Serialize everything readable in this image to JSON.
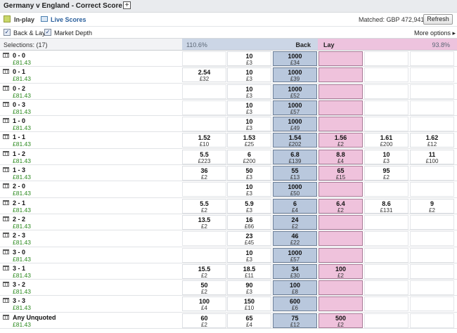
{
  "market": {
    "title": "Germany v England - Correct Score",
    "inplay_label": "In-play",
    "live_scores_label": "Live Scores",
    "matched_text": "Matched: GBP 472,941",
    "refresh_label": "Refresh"
  },
  "options": {
    "back_lay_label": "Back & Lay",
    "market_depth_label": "Market Depth",
    "more_options_label": "More options ▸",
    "back_lay_checked": true,
    "market_depth_checked": true
  },
  "header": {
    "selections_label": "Selections:  (17)",
    "back_pct": "110.6%",
    "back_label": "Back",
    "lay_label": "Lay",
    "lay_pct": "93.8%"
  },
  "colors": {
    "best_back": "#b9c8dd",
    "best_lay": "#efc2dc",
    "profit_green": "#2c8a1f"
  },
  "runners": [
    {
      "name": "0 - 0",
      "pl": "£81.43",
      "back": [
        null,
        {
          "p": "10",
          "s": "£3"
        },
        {
          "p": "1000",
          "s": "£34"
        }
      ],
      "lay": [
        null,
        null,
        null
      ]
    },
    {
      "name": "0 - 1",
      "pl": "£81.43",
      "back": [
        {
          "p": "2.54",
          "s": "£32"
        },
        {
          "p": "10",
          "s": "£3"
        },
        {
          "p": "1000",
          "s": "£39"
        }
      ],
      "lay": [
        null,
        null,
        null
      ]
    },
    {
      "name": "0 - 2",
      "pl": "£81.43",
      "back": [
        null,
        {
          "p": "10",
          "s": "£3"
        },
        {
          "p": "1000",
          "s": "£52"
        }
      ],
      "lay": [
        null,
        null,
        null
      ]
    },
    {
      "name": "0 - 3",
      "pl": "£81.43",
      "back": [
        null,
        {
          "p": "10",
          "s": "£3"
        },
        {
          "p": "1000",
          "s": "£57"
        }
      ],
      "lay": [
        null,
        null,
        null
      ]
    },
    {
      "name": "1 - 0",
      "pl": "£81.43",
      "back": [
        null,
        {
          "p": "10",
          "s": "£3"
        },
        {
          "p": "1000",
          "s": "£49"
        }
      ],
      "lay": [
        null,
        null,
        null
      ]
    },
    {
      "name": "1 - 1",
      "pl": "£81.43",
      "back": [
        {
          "p": "1.52",
          "s": "£10"
        },
        {
          "p": "1.53",
          "s": "£25"
        },
        {
          "p": "1.54",
          "s": "£202"
        }
      ],
      "lay": [
        {
          "p": "1.56",
          "s": "£2"
        },
        {
          "p": "1.61",
          "s": "£200"
        },
        {
          "p": "1.62",
          "s": "£12"
        }
      ]
    },
    {
      "name": "1 - 2",
      "pl": "£81.43",
      "back": [
        {
          "p": "5.5",
          "s": "£223"
        },
        {
          "p": "6",
          "s": "£200"
        },
        {
          "p": "6.8",
          "s": "£139"
        }
      ],
      "lay": [
        {
          "p": "8.8",
          "s": "£4"
        },
        {
          "p": "10",
          "s": "£3"
        },
        {
          "p": "11",
          "s": "£100"
        }
      ]
    },
    {
      "name": "1 - 3",
      "pl": "£81.43",
      "back": [
        {
          "p": "36",
          "s": "£2"
        },
        {
          "p": "50",
          "s": "£3"
        },
        {
          "p": "55",
          "s": "£13"
        }
      ],
      "lay": [
        {
          "p": "65",
          "s": "£15"
        },
        {
          "p": "95",
          "s": "£2"
        },
        null
      ]
    },
    {
      "name": "2 - 0",
      "pl": "£81.43",
      "back": [
        null,
        {
          "p": "10",
          "s": "£3"
        },
        {
          "p": "1000",
          "s": "£50"
        }
      ],
      "lay": [
        null,
        null,
        null
      ]
    },
    {
      "name": "2 - 1",
      "pl": "£81.43",
      "back": [
        {
          "p": "5.5",
          "s": "£2"
        },
        {
          "p": "5.9",
          "s": "£3"
        },
        {
          "p": "6",
          "s": "£4"
        }
      ],
      "lay": [
        {
          "p": "6.4",
          "s": "£2"
        },
        {
          "p": "8.6",
          "s": "£131"
        },
        {
          "p": "9",
          "s": "£2"
        }
      ]
    },
    {
      "name": "2 - 2",
      "pl": "£81.43",
      "back": [
        {
          "p": "13.5",
          "s": "£2"
        },
        {
          "p": "16",
          "s": "£66"
        },
        {
          "p": "24",
          "s": "£2"
        }
      ],
      "lay": [
        null,
        null,
        null
      ]
    },
    {
      "name": "2 - 3",
      "pl": "£81.43",
      "back": [
        null,
        {
          "p": "23",
          "s": "£45"
        },
        {
          "p": "46",
          "s": "£22"
        }
      ],
      "lay": [
        null,
        null,
        null
      ]
    },
    {
      "name": "3 - 0",
      "pl": "£81.43",
      "back": [
        null,
        {
          "p": "10",
          "s": "£3"
        },
        {
          "p": "1000",
          "s": "£57"
        }
      ],
      "lay": [
        null,
        null,
        null
      ]
    },
    {
      "name": "3 - 1",
      "pl": "£81.43",
      "back": [
        {
          "p": "15.5",
          "s": "£2"
        },
        {
          "p": "18.5",
          "s": "£11"
        },
        {
          "p": "34",
          "s": "£30"
        }
      ],
      "lay": [
        {
          "p": "100",
          "s": "£2"
        },
        null,
        null
      ]
    },
    {
      "name": "3 - 2",
      "pl": "£81.43",
      "back": [
        {
          "p": "50",
          "s": "£2"
        },
        {
          "p": "90",
          "s": "£3"
        },
        {
          "p": "100",
          "s": "£8"
        }
      ],
      "lay": [
        null,
        null,
        null
      ]
    },
    {
      "name": "3 - 3",
      "pl": "£81.43",
      "back": [
        {
          "p": "100",
          "s": "£4"
        },
        {
          "p": "150",
          "s": "£10"
        },
        {
          "p": "600",
          "s": "£6"
        }
      ],
      "lay": [
        null,
        null,
        null
      ]
    },
    {
      "name": "Any Unquoted",
      "pl": "£81.43",
      "back": [
        {
          "p": "60",
          "s": "£2"
        },
        {
          "p": "65",
          "s": "£4"
        },
        {
          "p": "75",
          "s": "£12"
        }
      ],
      "lay": [
        {
          "p": "500",
          "s": "£2"
        },
        null,
        null
      ]
    }
  ]
}
